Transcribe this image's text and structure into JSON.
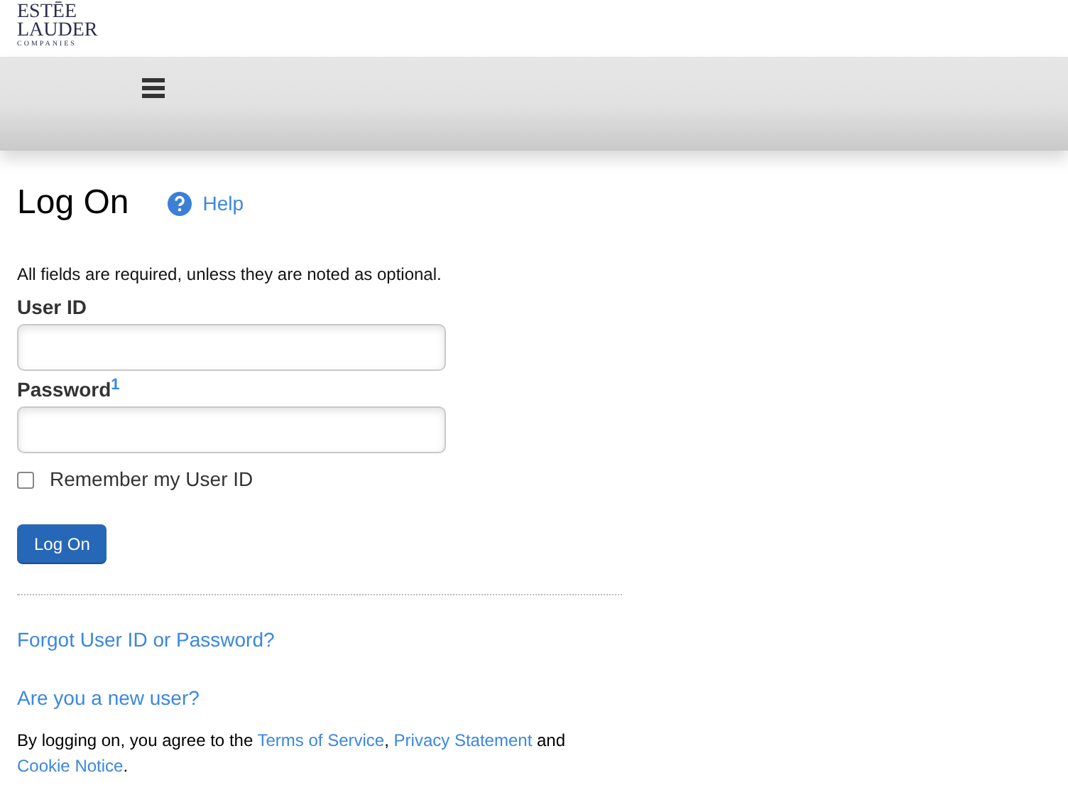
{
  "logo": {
    "line_1": "ESTĒE",
    "line_2": "LAUDER",
    "line_3": "COMPANIES"
  },
  "title": "Log On",
  "help_link": "Help",
  "instructions": "All fields are required, unless they are noted as optional.",
  "fields": [
    {
      "label": "User ID"
    },
    {
      "label": "Password$^{1}$"
    }
  ],
  "remember": {
    "label": "Remember my User ID",
    "checked": false
  },
  "submit_button": "Log On",
  "links": [
    "Forgot User ID or Password?",
    "Are you a new user?"
  ],
  "agreement": [
    {
      "kind": "text",
      "text": "By logging on, you agree to the "
    },
    {
      "kind": "link",
      "text": "Terms of Service"
    },
    {
      "kind": "text",
      "text": ", "
    },
    {
      "kind": "link",
      "text": "Privacy Statement"
    },
    {
      "kind": "text",
      "text": " and "
    },
    {
      "kind": "link",
      "text": "Cookie Notice"
    },
    {
      "kind": "text",
      "text": "."
    }
  ]
}
